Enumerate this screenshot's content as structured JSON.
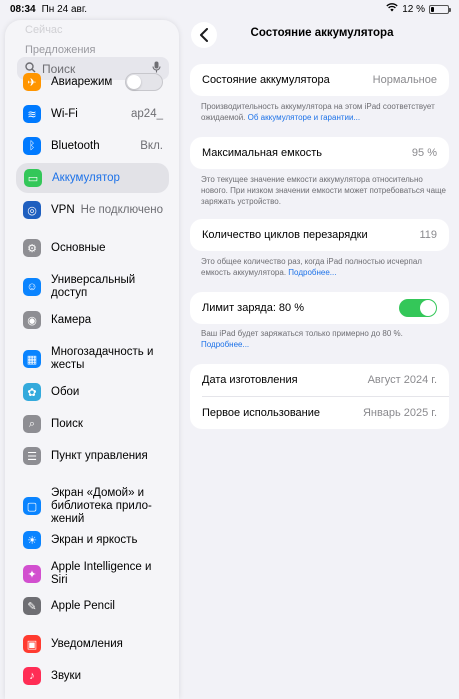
{
  "status_bar": {
    "time": "08:34",
    "date": "Пн 24 авг.",
    "battery_percent": "12 %"
  },
  "sidebar": {
    "faded_top": "Сейчас",
    "section_label": "Предложения",
    "search_placeholder": "Поиск",
    "items": [
      {
        "label": "Авиарежим",
        "value": "",
        "icon": "airplane-icon",
        "color": "#ff9500",
        "glyph": "✈"
      },
      {
        "label": "Wi-Fi",
        "value": "ap24_",
        "icon": "wifi-icon",
        "color": "#007aff",
        "glyph": "≋"
      },
      {
        "label": "Bluetooth",
        "value": "Вкл.",
        "icon": "bluetooth-icon",
        "color": "#007aff",
        "glyph": "ᛒ"
      },
      {
        "label": "Аккумулятор",
        "value": "",
        "icon": "battery-icon",
        "color": "#34c759",
        "glyph": "▭"
      },
      {
        "label": "VPN",
        "value": "Не подключено",
        "icon": "vpn-icon",
        "color": "#1f5fbf",
        "glyph": "◎"
      },
      {
        "label": "Основные",
        "value": "",
        "icon": "gear-icon",
        "color": "#8e8e93",
        "glyph": "⚙"
      },
      {
        "label": "Универсальный доступ",
        "value": "",
        "icon": "accessibility-icon",
        "color": "#0a84ff",
        "glyph": "☺"
      },
      {
        "label": "Камера",
        "value": "",
        "icon": "camera-icon",
        "color": "#8e8e93",
        "glyph": "◉"
      },
      {
        "label": "Многозадачность и жесты",
        "value": "",
        "icon": "multitasking-icon",
        "color": "#0a84ff",
        "glyph": "▦"
      },
      {
        "label": "Обои",
        "value": "",
        "icon": "wallpaper-icon",
        "color": "#34aadc",
        "glyph": "✿"
      },
      {
        "label": "Поиск",
        "value": "",
        "icon": "search-icon",
        "color": "#8e8e93",
        "glyph": "⌕"
      },
      {
        "label": "Пункт управления",
        "value": "",
        "icon": "control-center-icon",
        "color": "#8e8e93",
        "glyph": "☰"
      },
      {
        "label": "Экран «Домой» и библиотека прило-жений",
        "value": "",
        "icon": "home-screen-icon",
        "color": "#0a84ff",
        "glyph": "▢"
      },
      {
        "label": "Экран и яркость",
        "value": "",
        "icon": "brightness-icon",
        "color": "#0a84ff",
        "glyph": "☀"
      },
      {
        "label": "Apple Intelligence и Siri",
        "value": "",
        "icon": "siri-icon",
        "color": "#d24fcf",
        "glyph": "✦"
      },
      {
        "label": "Apple Pencil",
        "value": "",
        "icon": "pencil-icon",
        "color": "#6e6e73",
        "glyph": "✎"
      },
      {
        "label": "Уведомления",
        "value": "",
        "icon": "notifications-icon",
        "color": "#ff3b30",
        "glyph": "▣"
      },
      {
        "label": "Звуки",
        "value": "",
        "icon": "sounds-icon",
        "color": "#ff2d55",
        "glyph": "♪"
      }
    ]
  },
  "main": {
    "title": "Состояние аккумулятора",
    "health": {
      "label": "Состояние аккумулятора",
      "value": "Нормальное"
    },
    "health_note": "Производительность аккумулятора на этом iPad соответствует ожидаемой.",
    "health_note_link": "Об аккумуляторе и гарантии...",
    "capacity": {
      "label": "Максимальная емкость",
      "value": "95 %"
    },
    "capacity_note": "Это текущее значение емкости аккумулятора относительно нового. При низком значении емкости может потребоваться чаще заряжать устройство.",
    "cycles": {
      "label": "Количество циклов перезарядки",
      "value": "119"
    },
    "cycles_note": "Это общее количество раз, когда iPad полностью исчерпал емкость аккумулятора.",
    "cycles_note_link": "Подробнее...",
    "charge_limit": {
      "label": "Лимит заряда: 80 %",
      "enabled": true
    },
    "charge_limit_note": "Ваш iPad будет заряжаться только примерно до 80 %.",
    "charge_limit_note_link": "Подробнее...",
    "manufacture": {
      "label": "Дата изготовления",
      "value": "Август 2024 г."
    },
    "first_use": {
      "label": "Первое использование",
      "value": "Январь 2025 г."
    }
  },
  "colors": {
    "accent": "#1d72e8",
    "toggle_on": "#34c759",
    "background": "#f2f2f7"
  }
}
